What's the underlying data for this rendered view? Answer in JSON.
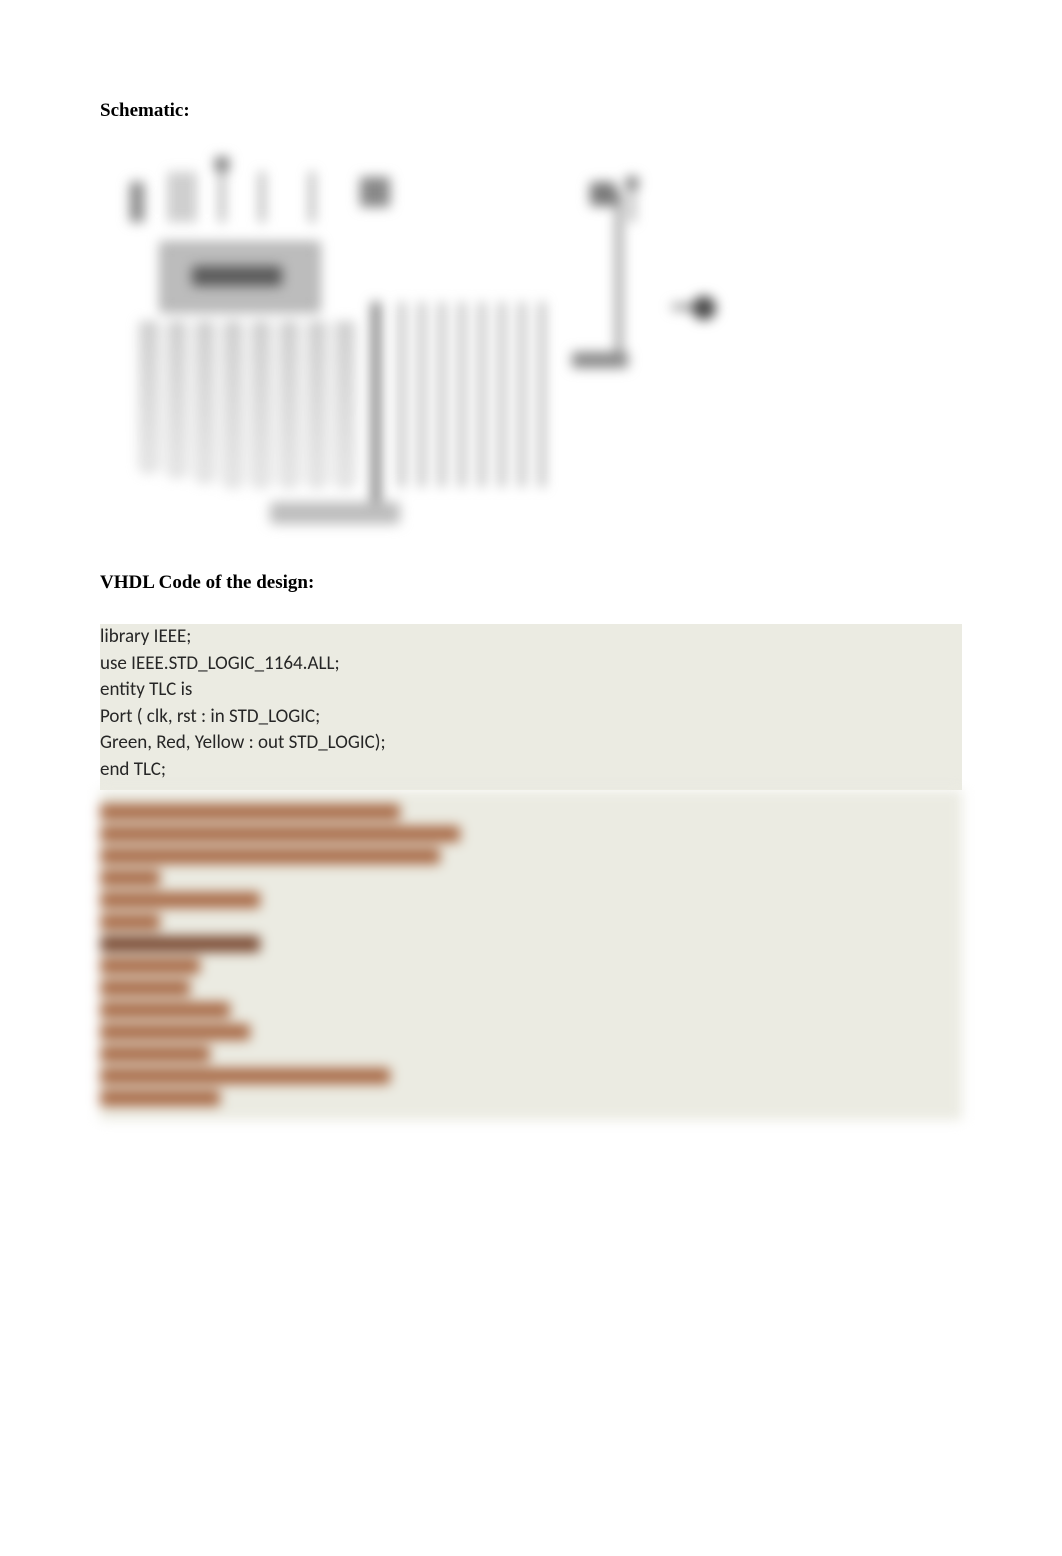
{
  "headings": {
    "schematic": "Schematic:",
    "vhdl": "VHDL Code of the design:"
  },
  "code": {
    "l1": "library IEEE;",
    "l2": "use IEEE.STD_LOGIC_1164.ALL;",
    "l3": "entity TLC is",
    "l4": "Port ( clk, rst : in STD_LOGIC;",
    "l5": "Green, Red, Yellow : out STD_LOGIC);",
    "l6": "end TLC;"
  }
}
